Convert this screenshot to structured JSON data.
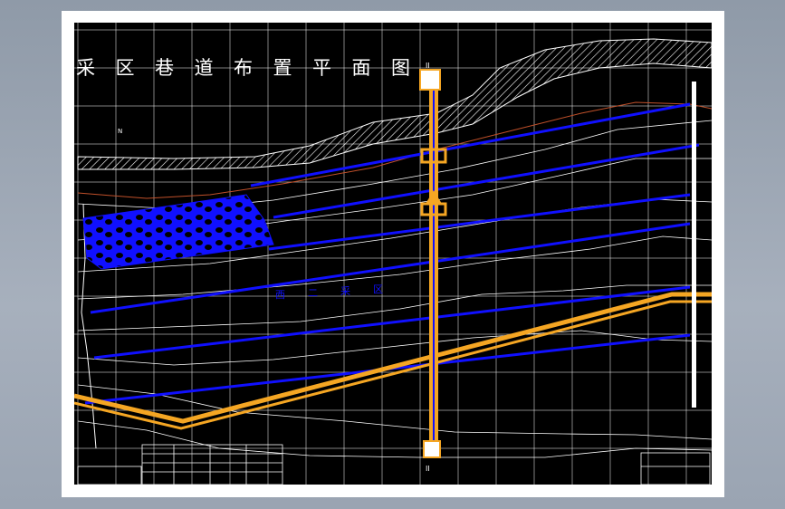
{
  "drawing": {
    "title": "采 区 巷 道 布 置 平 面 图",
    "title_chars": [
      "采",
      "区",
      "巷",
      "道",
      "布",
      "置",
      "平",
      "面",
      "图"
    ],
    "panel_label_chars": [
      "西",
      "二",
      "采",
      "区"
    ],
    "section_marks": {
      "top": "II",
      "bottom": "II"
    },
    "north_mark": "N"
  },
  "colors": {
    "background": "#000000",
    "grid": "#ffffff",
    "roadway": "#1010ff",
    "main_roadway": "#f5a623",
    "contour": "#ffffff",
    "boundary": "#c0502a",
    "goaf_fill": "#1010ff"
  }
}
